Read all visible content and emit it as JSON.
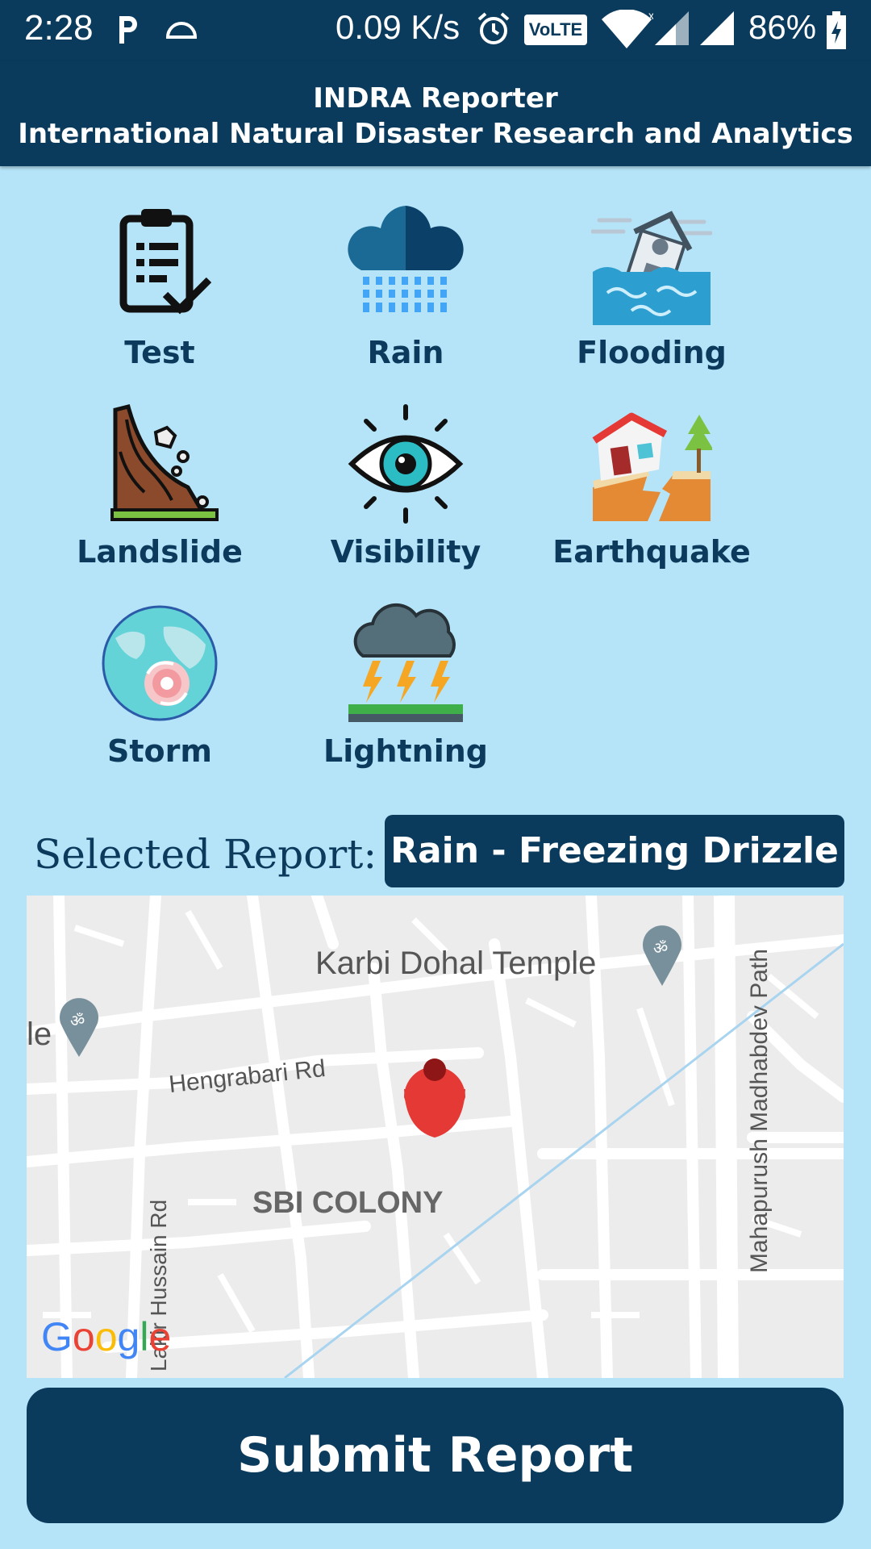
{
  "status_bar": {
    "time": "2:28",
    "network_speed": "0.09 K/s",
    "volte": "VoLTE",
    "battery": "86%",
    "icons": [
      "parking-icon",
      "cloud-icon",
      "alarm-icon",
      "wifi-icon",
      "signal-icon",
      "battery-charging-icon"
    ]
  },
  "header": {
    "title": "INDRA Reporter",
    "subtitle": "International Natural Disaster Research and Analytics"
  },
  "categories": [
    {
      "label": "Test",
      "icon": "clipboard-check-icon"
    },
    {
      "label": "Rain",
      "icon": "rain-cloud-icon"
    },
    {
      "label": "Flooding",
      "icon": "flood-house-icon"
    },
    {
      "label": "Landslide",
      "icon": "landslide-icon"
    },
    {
      "label": "Visibility",
      "icon": "eye-icon"
    },
    {
      "label": "Earthquake",
      "icon": "earthquake-house-icon"
    },
    {
      "label": "Storm",
      "icon": "cyclone-globe-icon"
    },
    {
      "label": "Lightning",
      "icon": "thunderstorm-icon"
    }
  ],
  "selected_report": {
    "label": "Selected Report:",
    "value": "Rain - Freezing Drizzle"
  },
  "map": {
    "labels": {
      "temple": "Karbi Dohal Temple",
      "road_main": "Hengrabari Rd",
      "colony": "SBI COLONY",
      "road_vertical_right": "Mahapurush Madhabdev Path",
      "road_vertical_left": "Lakir Hussain Rd",
      "partial_left": "le"
    },
    "google_logo": "Google",
    "pin_color": "#e53935"
  },
  "submit_button": {
    "label": "Submit Report"
  },
  "colors": {
    "primary": "#0a3a5c",
    "background": "#b5e4f8"
  }
}
